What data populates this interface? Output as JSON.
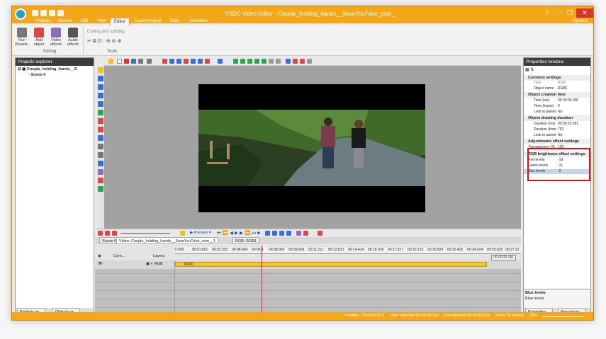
{
  "app": {
    "title": "VSDC Video Editor - Couple_holding_hands__SaveYouTube_com_",
    "window_controls": [
      "?",
      "–",
      "❐",
      "✕"
    ],
    "options_label": "Options"
  },
  "menu": {
    "tabs": [
      "Projects",
      "Scenes",
      "Edit",
      "View",
      "Editor",
      "Export project",
      "Tools",
      "Activation"
    ],
    "active_tab": "Editor"
  },
  "ribbon": {
    "editing": {
      "group_label": "Editing",
      "buttons": [
        "Run Wizard...",
        "Add object",
        "Video effects",
        "Audio effects"
      ]
    },
    "tools": {
      "group_label": "Tools",
      "cutting_label": "Cutting and splitting"
    }
  },
  "projects_explorer": {
    "title": "Projects explorer",
    "tree": [
      {
        "label": "Couple_holding_hands__S",
        "level": 0
      },
      {
        "label": "Scene 0",
        "level": 1
      }
    ],
    "tabs": [
      "Projects ex...",
      "Objects ex..."
    ]
  },
  "timeline": {
    "toolbar": {
      "preview_label": "Preview"
    },
    "tabs": [
      "Scene 0",
      "Video: Couple_holding_hands__SaveYouTube_com__1",
      "RGB: RGB1"
    ],
    "columns": [
      "Com...",
      "Layers"
    ],
    "ruler_ticks": [
      "0.000",
      "00:01.601",
      "00:03.203",
      "00:04.804",
      "00:06.4",
      "00:08.008",
      "00:09.609",
      "00:11.211",
      "00:12.812",
      "00:14.414",
      "00:16.016",
      "00:17.617",
      "00:19.219",
      "00:20.820",
      "00:22.422",
      "00:24.024",
      "00:25.625",
      "00:27.22"
    ],
    "end_time": "00:00:25.091",
    "track": {
      "layer": "RGB",
      "clip_label": "RGB1"
    }
  },
  "properties": {
    "title": "Properties window",
    "sections": [
      {
        "header": "Common settings",
        "rows": [
          {
            "label": "Type",
            "value": "RGB"
          },
          {
            "label": "Object name",
            "value": "RGB1"
          }
        ]
      },
      {
        "header": "Object creation time",
        "rows": [
          {
            "label": "Time (ms)",
            "value": "00:00:00.000"
          },
          {
            "label": "Time (frame)",
            "value": "0"
          },
          {
            "label": "Lock to parent",
            "value": "No"
          }
        ]
      },
      {
        "header": "Object drawing duration",
        "rows": [
          {
            "label": "Duration (ms)",
            "value": "00:00:25.091"
          },
          {
            "label": "Duration (fram",
            "value": "752"
          },
          {
            "label": "Lock to parent",
            "value": "No"
          }
        ]
      },
      {
        "header": "Adjustments effect settings",
        "rows": [
          {
            "label": "Transparency (%",
            "value": "100"
          }
        ]
      },
      {
        "header": "RGB brightness effect settings",
        "rows": [
          {
            "label": "Red levels",
            "value": "-19"
          },
          {
            "label": "Green levels",
            "value": "-11"
          },
          {
            "label": "Blue levels",
            "value": "-2"
          }
        ]
      }
    ],
    "help": {
      "title": "Blue levels",
      "text": "Blue levels"
    },
    "tabs": [
      "Properties ...",
      "Resources ..."
    ]
  },
  "status_bar": {
    "position_label": "Position",
    "position_value": "00:00:06.873",
    "start_selection_label": "Start selection",
    "start_selection_value": "00:00:00.000",
    "end_selection_label": "End selection",
    "end_selection_value": "00:00:00.000",
    "zoom_label": "Zoom To Screen",
    "zoom_value": "35%"
  },
  "colors": {
    "accent": "#f3a81a",
    "highlight": "#e01010",
    "clip": "#f6c52c"
  }
}
